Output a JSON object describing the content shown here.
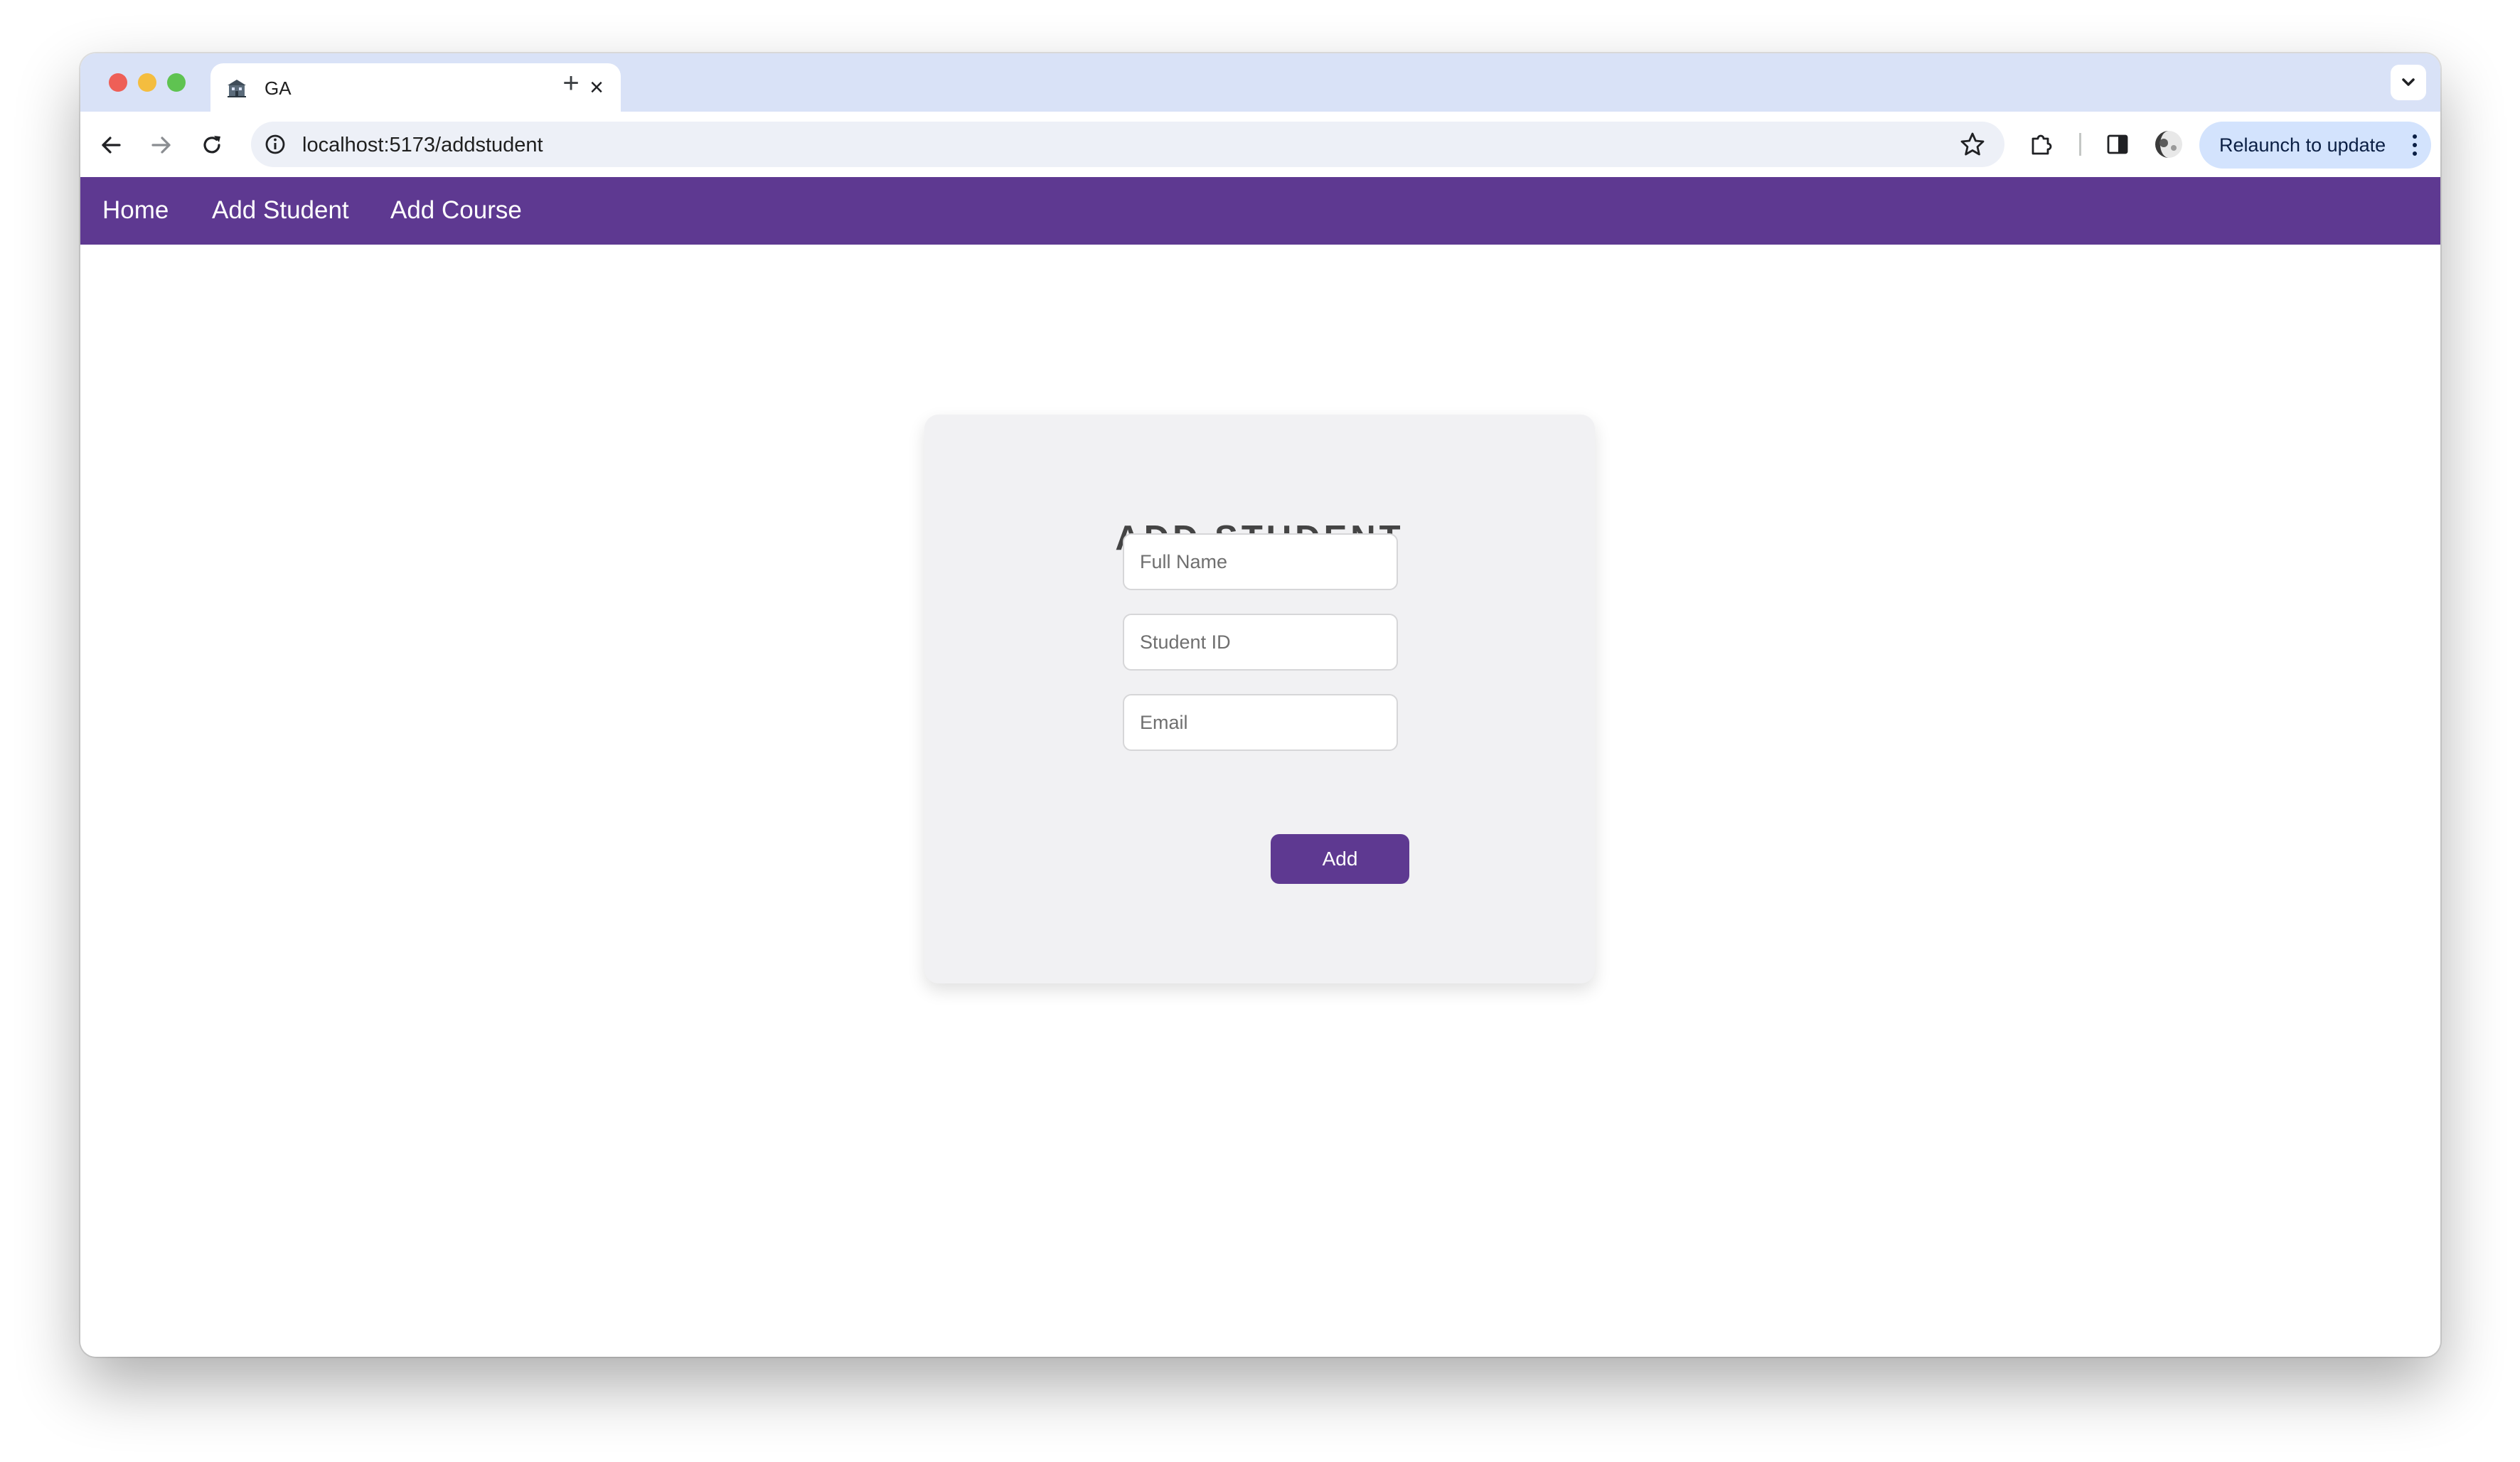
{
  "browser": {
    "tab": {
      "title": "GA",
      "favicon_icon": "school-building-icon",
      "close_icon": "close-icon"
    },
    "new_tab_icon": "plus-icon",
    "tab_search_icon": "chevron-down-icon",
    "toolbar": {
      "back_icon": "arrow-left-icon",
      "forward_icon": "arrow-right-icon",
      "reload_icon": "reload-icon",
      "site_info_icon": "info-icon",
      "url": "localhost:5173/addstudent",
      "bookmark_icon": "star-icon",
      "extensions_icon": "puzzle-icon",
      "side_panel_icon": "side-panel-icon",
      "profile_icon": "avatar",
      "relaunch_label": "Relaunch to update",
      "menu_icon": "kebab-menu-icon"
    }
  },
  "colors": {
    "accent": "#5e3991",
    "card_background": "#f1f1f3",
    "tabstrip": "#d9e2f7"
  },
  "navbar": {
    "links": [
      "Home",
      "Add Student",
      "Add Course"
    ]
  },
  "form": {
    "title": "ADD STUDENT",
    "fields": {
      "full_name_placeholder": "Full Name",
      "student_id_placeholder": "Student ID",
      "email_placeholder": "Email"
    },
    "submit_label": "Add"
  }
}
